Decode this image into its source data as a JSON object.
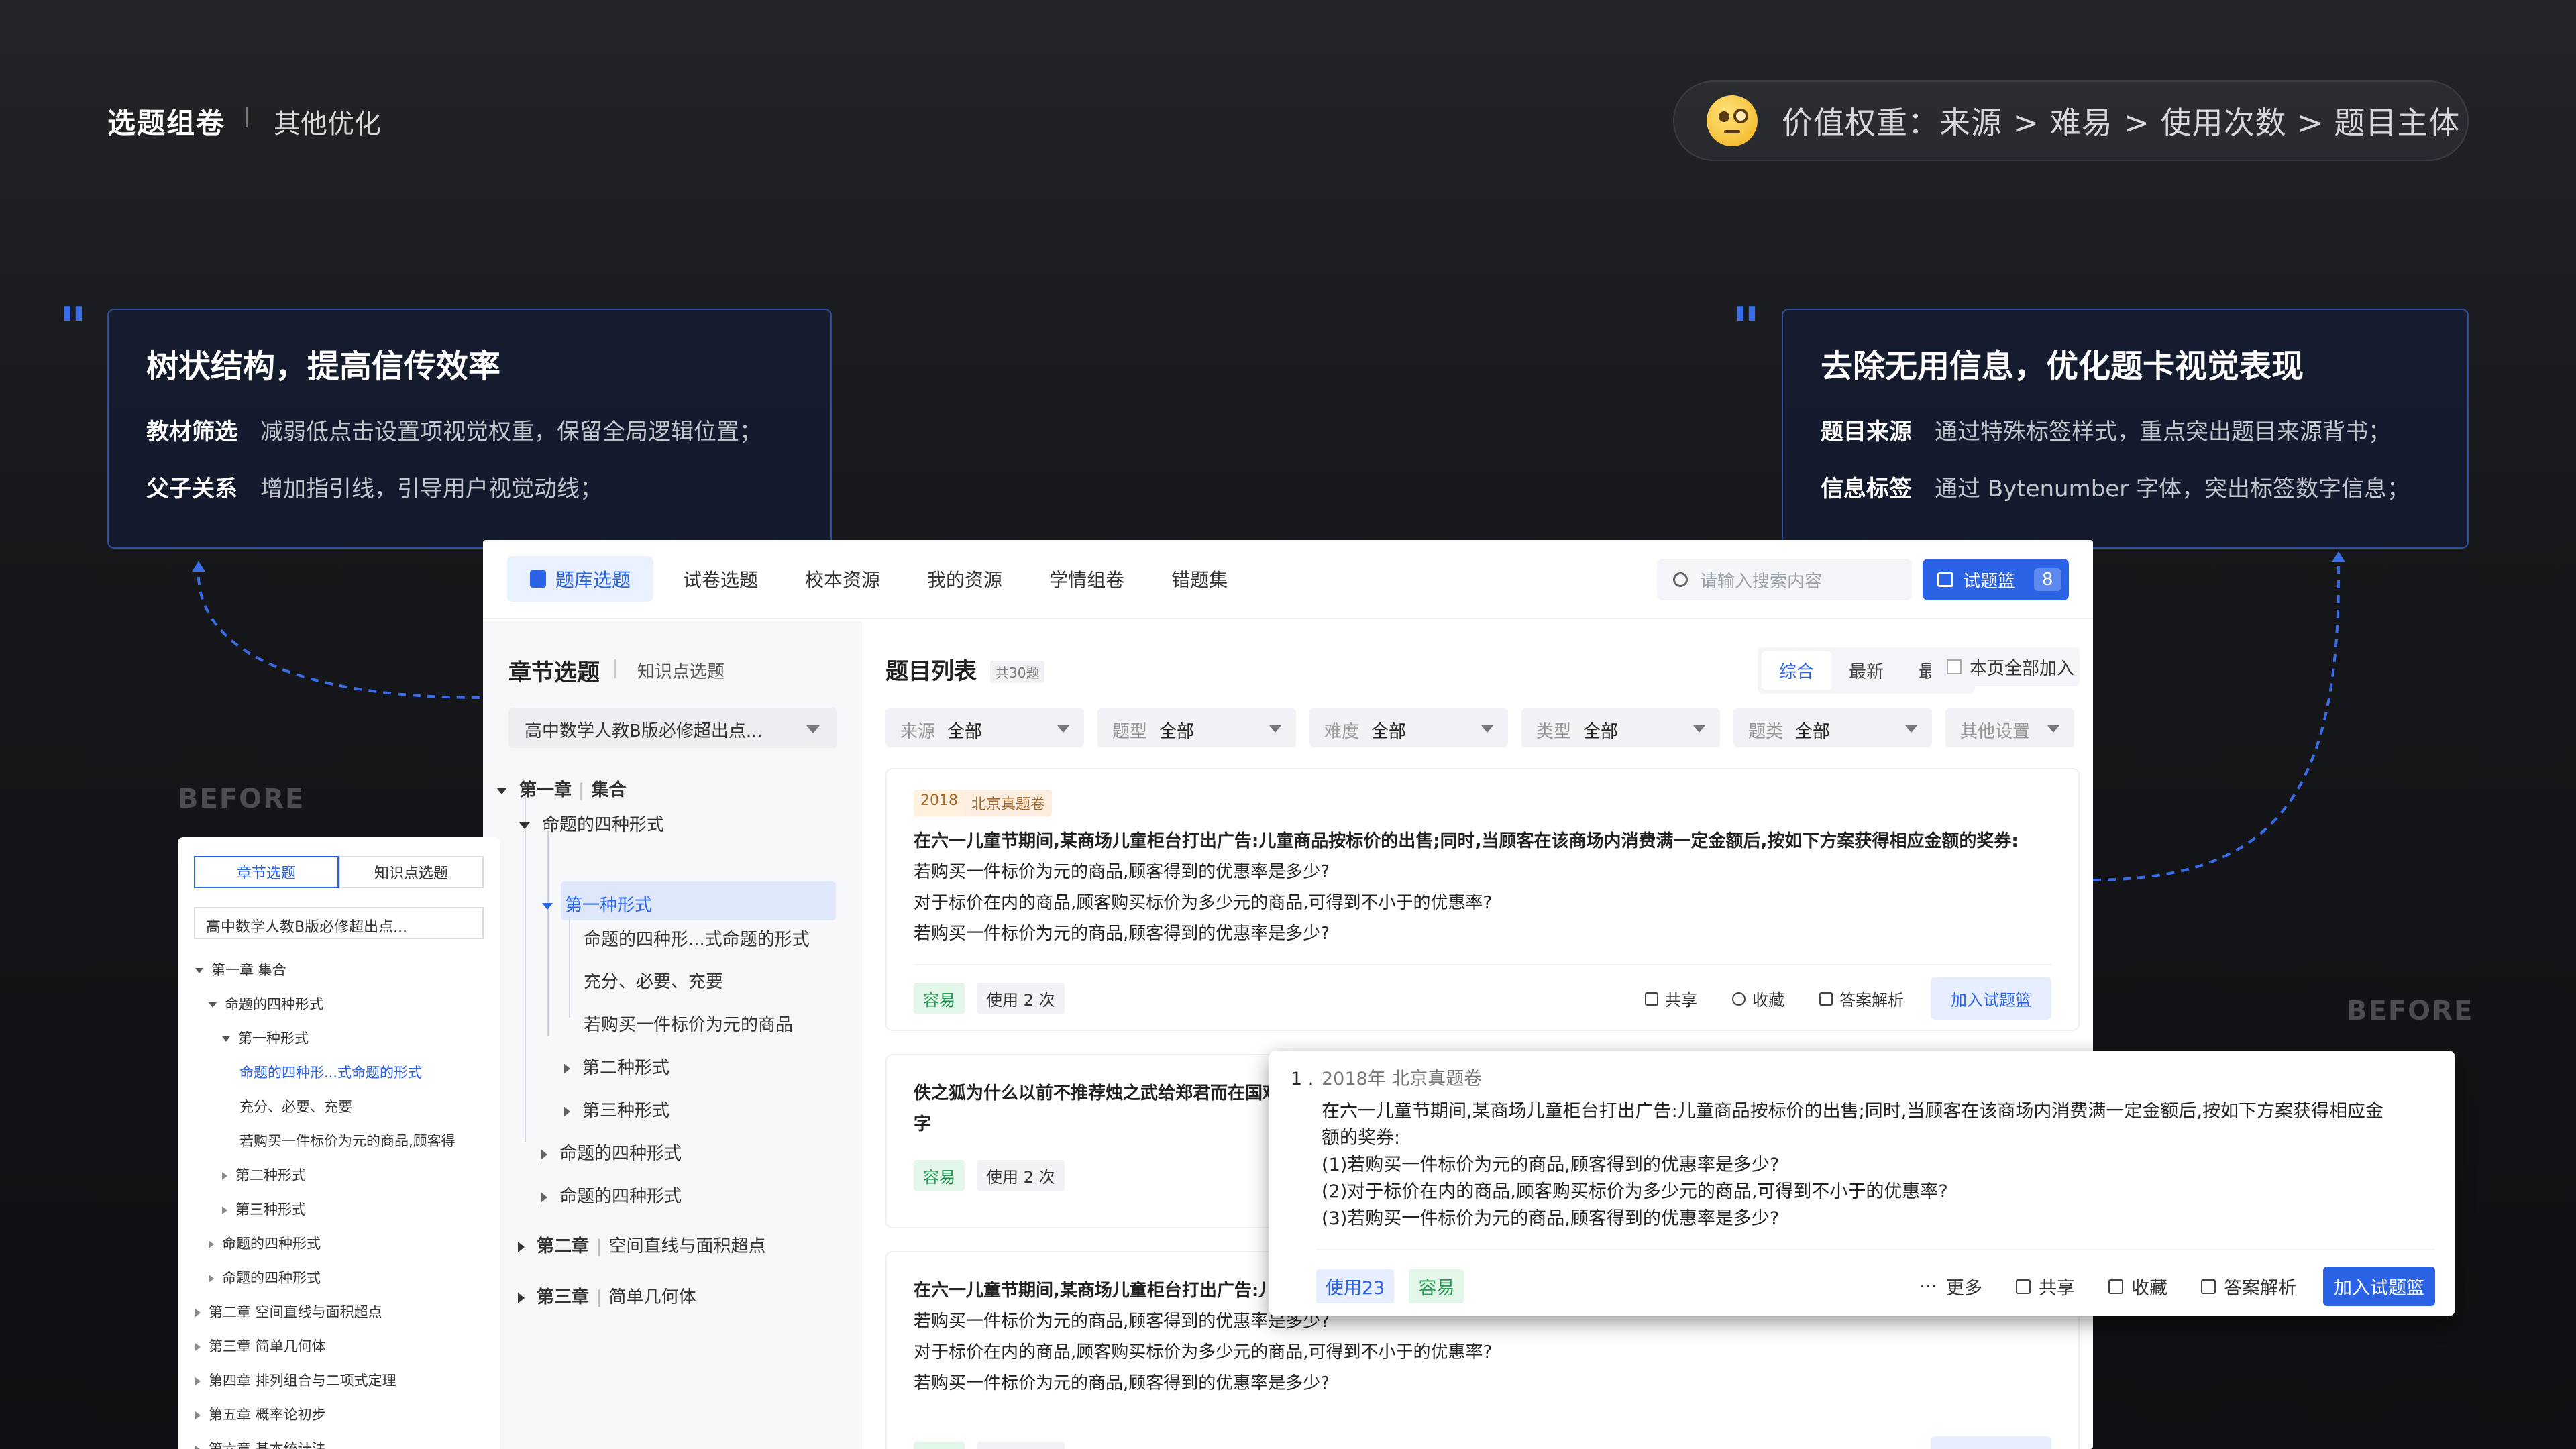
{
  "header": {
    "title": "选题组卷",
    "subtitle": "其他优化",
    "pill_text": "价值权重：来源 > 难易 > 使用次数 > 题目主体"
  },
  "left_card": {
    "title": "树状结构，提高信传效率",
    "rows": [
      {
        "label": "教材筛选",
        "text": "减弱低点击设置项视觉权重，保留全局逻辑位置；"
      },
      {
        "label": "父子关系",
        "text": "增加指引线，引导用户视觉动线；"
      }
    ]
  },
  "right_card": {
    "title": "去除无用信息，优化题卡视觉表现",
    "rows": [
      {
        "label": "题目来源",
        "text": "通过特殊标签样式，重点突出题目来源背书；"
      },
      {
        "label": "信息标签",
        "text": "通过 Bytenumber 字体，突出标签数字信息；"
      }
    ]
  },
  "before_label": "BEFORE",
  "app": {
    "nav": [
      "题库选题",
      "试卷选题",
      "校本资源",
      "我的资源",
      "学情组卷",
      "错题集"
    ],
    "search_placeholder": "请输入搜索内容",
    "basket_label": "试题篮",
    "basket_count": "8",
    "side": {
      "tab_active": "章节选题",
      "tab_other": "知识点选题",
      "textbook": "高中数学人教B版必修超出点...",
      "tree": [
        "第一章",
        "集合",
        "命题的四种形式",
        "第一种形式",
        "命题的四种形...式命题的形式",
        "充分、必要、充要",
        "若购买一件标价为元的商品",
        "第二种形式",
        "第三种形式",
        "命题的四种形式",
        "命题的四种形式",
        "第二章",
        "空间直线与面积超点",
        "第三章",
        "简单几何体"
      ]
    },
    "list": {
      "title": "题目列表",
      "count": "共30题",
      "sort": [
        "综合",
        "最新",
        "最热"
      ],
      "all_page": "本页全部加入",
      "filters": [
        {
          "label": "来源",
          "value": "全部"
        },
        {
          "label": "题型",
          "value": "全部"
        },
        {
          "label": "难度",
          "value": "全部"
        },
        {
          "label": "类型",
          "value": "全部"
        },
        {
          "label": "题类",
          "value": "全部"
        }
      ],
      "other_settings": "其他设置",
      "q1": {
        "year": "2018",
        "source": "北京真题卷",
        "lines": [
          "在六一儿童节期间,某商场儿童柜台打出广告:儿童商品按标价的出售;同时,当顾客在该商场内消费满一定金额后,按如下方案获得相应金额的奖券:",
          "若购买一件标价为元的商品,顾客得到的优惠率是多少?",
          "对于标价在内的商品,顾客购买标价为多少元的商品,可得到不小于的优惠率?",
          "若购买一件标价为元的商品,顾客得到的优惠率是多少?"
        ]
      },
      "q2": {
        "lines": [
          "佚之狐为什么以前不推荐烛之武给郑君而在国难",
          "字"
        ]
      },
      "q3": {
        "lines": [
          "在六一儿童节期间,某商场儿童柜台打出广告:儿",
          "若购买一件标价为元的商品,顾客得到的优惠率是多少?",
          "对于标价在内的商品,顾客购买标价为多少元的商品,可得到不小于的优惠率?",
          "若购买一件标价为元的商品,顾客得到的优惠率是多少?"
        ]
      },
      "difficulty": "容易",
      "used": "使用 2 次",
      "actions": [
        "共享",
        "收藏",
        "答案解析"
      ],
      "add_label": "加入试题篮"
    }
  },
  "before_left": {
    "tab_active": "章节选题",
    "tab_other": "知识点选题",
    "textbook": "高中数学人教B版必修超出点...",
    "tree": [
      "第一章 集合",
      "命题的四种形式",
      "第一种形式",
      "命题的四种形...式命题的形式",
      "充分、必要、充要",
      "若购买一件标价为元的商品,顾客得",
      "第二种形式",
      "第三种形式",
      "命题的四种形式",
      "命题的四种形式",
      "第二章 空间直线与面积超点",
      "第三章 简单几何体",
      "第四章 排列组合与二项式定理",
      "第五章 概率论初步",
      "第六章 基本统计法"
    ]
  },
  "before_right": {
    "number": "1 .",
    "meta": "2018年 北京真题卷",
    "lines": [
      "在六一儿童节期间,某商场儿童柜台打出广告:儿童商品按标价的出售;同时,当顾客在该商场内消费满一定金额后,按如下方案获得相应金",
      "额的奖券:",
      "(1)若购买一件标价为元的商品,顾客得到的优惠率是多少?",
      "(2)对于标价在内的商品,顾客购买标价为多少元的商品,可得到不小于的优惠率?",
      "(3)若购买一件标价为元的商品,顾客得到的优惠率是多少?"
    ],
    "used": "使用23",
    "difficulty": "容易",
    "actions": [
      "更多",
      "共享",
      "收藏",
      "答案解析"
    ],
    "add_label": "加入试题篮"
  }
}
